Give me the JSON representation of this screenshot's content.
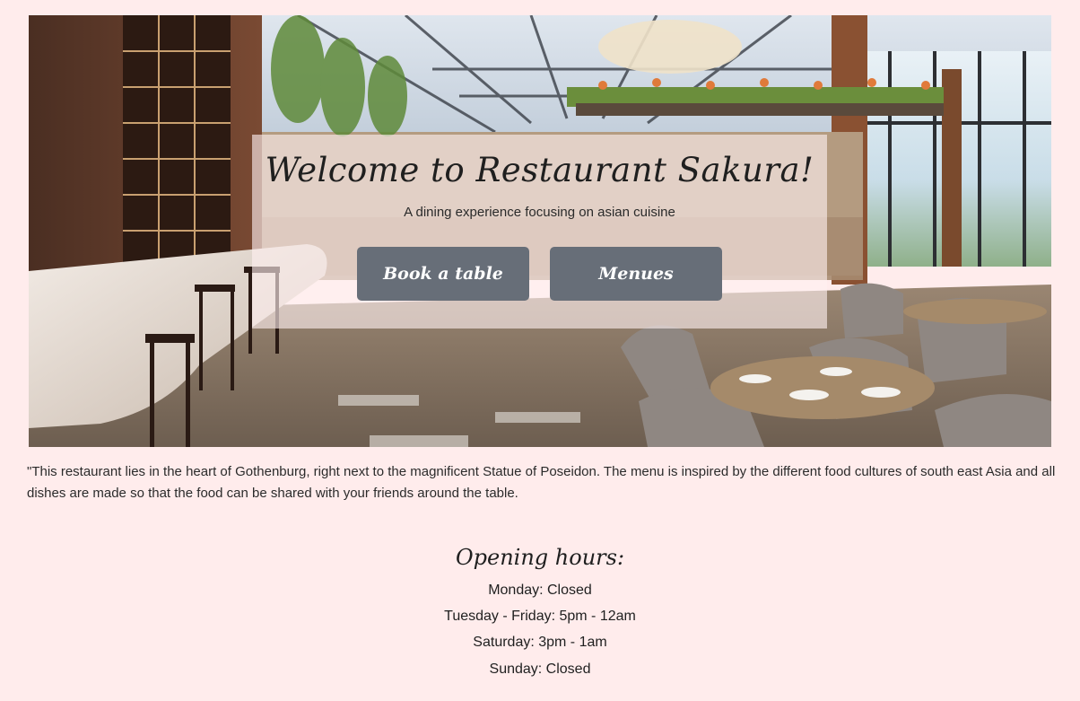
{
  "hero": {
    "title": "Welcome to Restaurant Sakura!",
    "subtitle": "A dining experience focusing on asian cuisine",
    "book_label": "Book a table",
    "menus_label": "Menues"
  },
  "intro": {
    "text": "\"This restaurant lies in the heart of Gothenburg, right next to the magnificent Statue of Poseidon. The menu is inspired by the different food cultures of south east Asia and all dishes are made so that the food can be shared with your friends around the table."
  },
  "hours": {
    "title": "Opening hours:",
    "lines": [
      "Monday: Closed",
      "Tuesday - Friday: 5pm - 12am",
      "Saturday: 3pm - 1am",
      "Sunday: Closed"
    ]
  },
  "colors": {
    "page_background": "#ffecec",
    "button_background": "#676e78",
    "button_text": "#ffffff",
    "overlay": "rgba(255,240,240,0.62)"
  }
}
